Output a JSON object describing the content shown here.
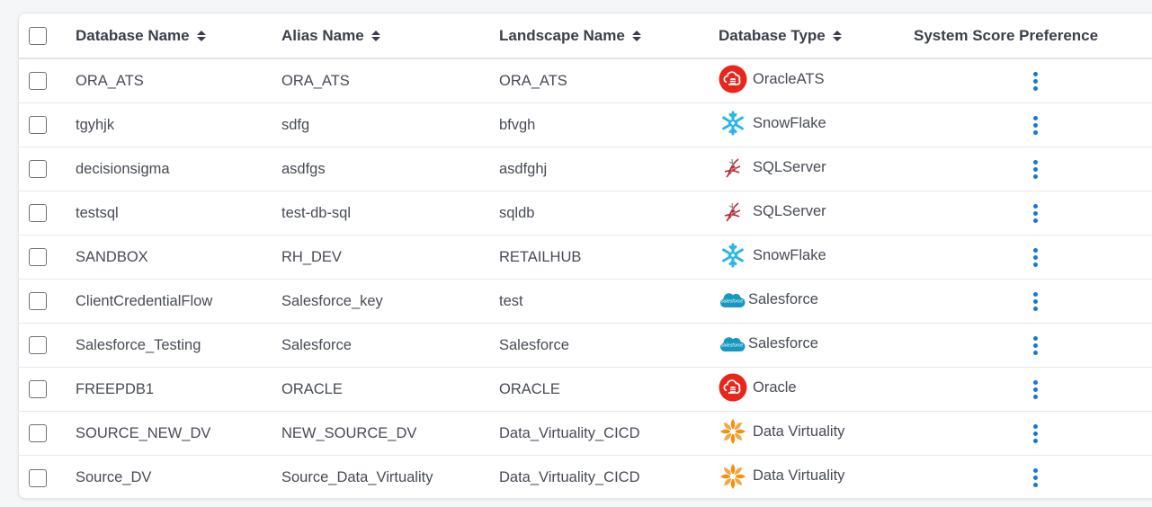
{
  "columns": {
    "database_name": "Database Name",
    "alias_name": "Alias Name",
    "landscape_name": "Landscape Name",
    "database_type": "Database Type",
    "system_score_preference": "System Score Preference"
  },
  "icons": {
    "sort": "sort-icon",
    "row_menu": "kebab-menu-icon",
    "oracle": "oracle-cloud-icon",
    "snowflake": "snowflake-icon",
    "sqlserver": "sqlserver-icon",
    "salesforce": "salesforce-cloud-icon",
    "datavirtuality": "data-virtuality-icon"
  },
  "colors": {
    "accent": "#1677d4",
    "oracle": "#e8261c",
    "snowflake": "#29b5e8",
    "salesforce": "#1798c1",
    "datavirtuality": "#f29111"
  },
  "rows": [
    {
      "database_name": "ORA_ATS",
      "alias_name": "ORA_ATS",
      "landscape_name": "ORA_ATS",
      "database_type": "OracleATS",
      "icon": "oracle"
    },
    {
      "database_name": "tgyhjk",
      "alias_name": "sdfg",
      "landscape_name": "bfvgh",
      "database_type": "SnowFlake",
      "icon": "snowflake"
    },
    {
      "database_name": "decisionsigma",
      "alias_name": "asdfgs",
      "landscape_name": "asdfghj",
      "database_type": "SQLServer",
      "icon": "sqlserver"
    },
    {
      "database_name": "testsql",
      "alias_name": "test-db-sql",
      "landscape_name": "sqldb",
      "database_type": "SQLServer",
      "icon": "sqlserver"
    },
    {
      "database_name": "SANDBOX",
      "alias_name": "RH_DEV",
      "landscape_name": "RETAILHUB",
      "database_type": "SnowFlake",
      "icon": "snowflake"
    },
    {
      "database_name": "ClientCredentialFlow",
      "alias_name": "Salesforce_key",
      "landscape_name": "test",
      "database_type": "Salesforce",
      "icon": "salesforce"
    },
    {
      "database_name": "Salesforce_Testing",
      "alias_name": "Salesforce",
      "landscape_name": "Salesforce",
      "database_type": "Salesforce",
      "icon": "salesforce"
    },
    {
      "database_name": "FREEPDB1",
      "alias_name": "ORACLE",
      "landscape_name": "ORACLE",
      "database_type": "Oracle",
      "icon": "oracle"
    },
    {
      "database_name": "SOURCE_NEW_DV",
      "alias_name": "NEW_SOURCE_DV",
      "landscape_name": "Data_Virtuality_CICD",
      "database_type": "Data Virtuality",
      "icon": "datavirtuality"
    },
    {
      "database_name": "Source_DV",
      "alias_name": "Source_Data_Virtuality",
      "landscape_name": "Data_Virtuality_CICD",
      "database_type": "Data Virtuality",
      "icon": "datavirtuality"
    }
  ]
}
